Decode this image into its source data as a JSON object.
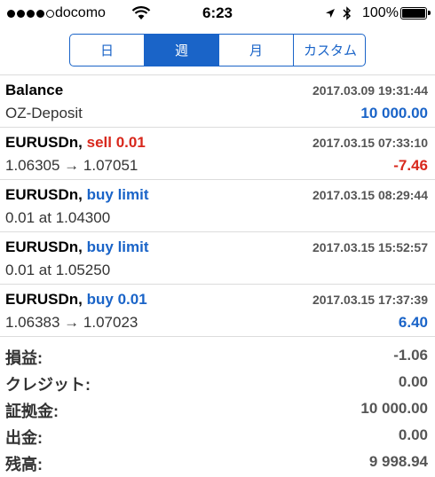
{
  "status_bar": {
    "carrier": "docomo",
    "time": "6:23",
    "battery": "100%"
  },
  "tabs": [
    {
      "label": "日",
      "active": false
    },
    {
      "label": "週",
      "active": true
    },
    {
      "label": "月",
      "active": false
    },
    {
      "label": "カスタム",
      "active": false
    }
  ],
  "entries": [
    {
      "symbol": "Balance",
      "action": "",
      "date": "2017.03.09 19:31:44",
      "detail": "OZ-Deposit",
      "amount": "10 000.00"
    },
    {
      "symbol": "EURUSDn,",
      "action": "sell 0.01",
      "date": "2017.03.15 07:33:10",
      "detail": "1.06305 → 1.07051",
      "amount": "-7.46"
    },
    {
      "symbol": "EURUSDn,",
      "action": "buy limit",
      "date": "2017.03.15 08:29:44",
      "detail": "0.01 at 1.04300",
      "amount": ""
    },
    {
      "symbol": "EURUSDn,",
      "action": "buy limit",
      "date": "2017.03.15 15:52:57",
      "detail": "0.01 at 1.05250",
      "amount": ""
    },
    {
      "symbol": "EURUSDn,",
      "action": "buy 0.01",
      "date": "2017.03.15 17:37:39",
      "detail": "1.06383 → 1.07023",
      "amount": "6.40"
    }
  ],
  "summary": [
    {
      "label": "損益:",
      "value": "-1.06"
    },
    {
      "label": "クレジット:",
      "value": "0.00"
    },
    {
      "label": "証拠金:",
      "value": "10 000.00"
    },
    {
      "label": "出金:",
      "value": "0.00"
    },
    {
      "label": "残高:",
      "value": "9 998.94"
    }
  ],
  "colors": {
    "accent": "#1a64c8",
    "negative": "#d8281c"
  }
}
